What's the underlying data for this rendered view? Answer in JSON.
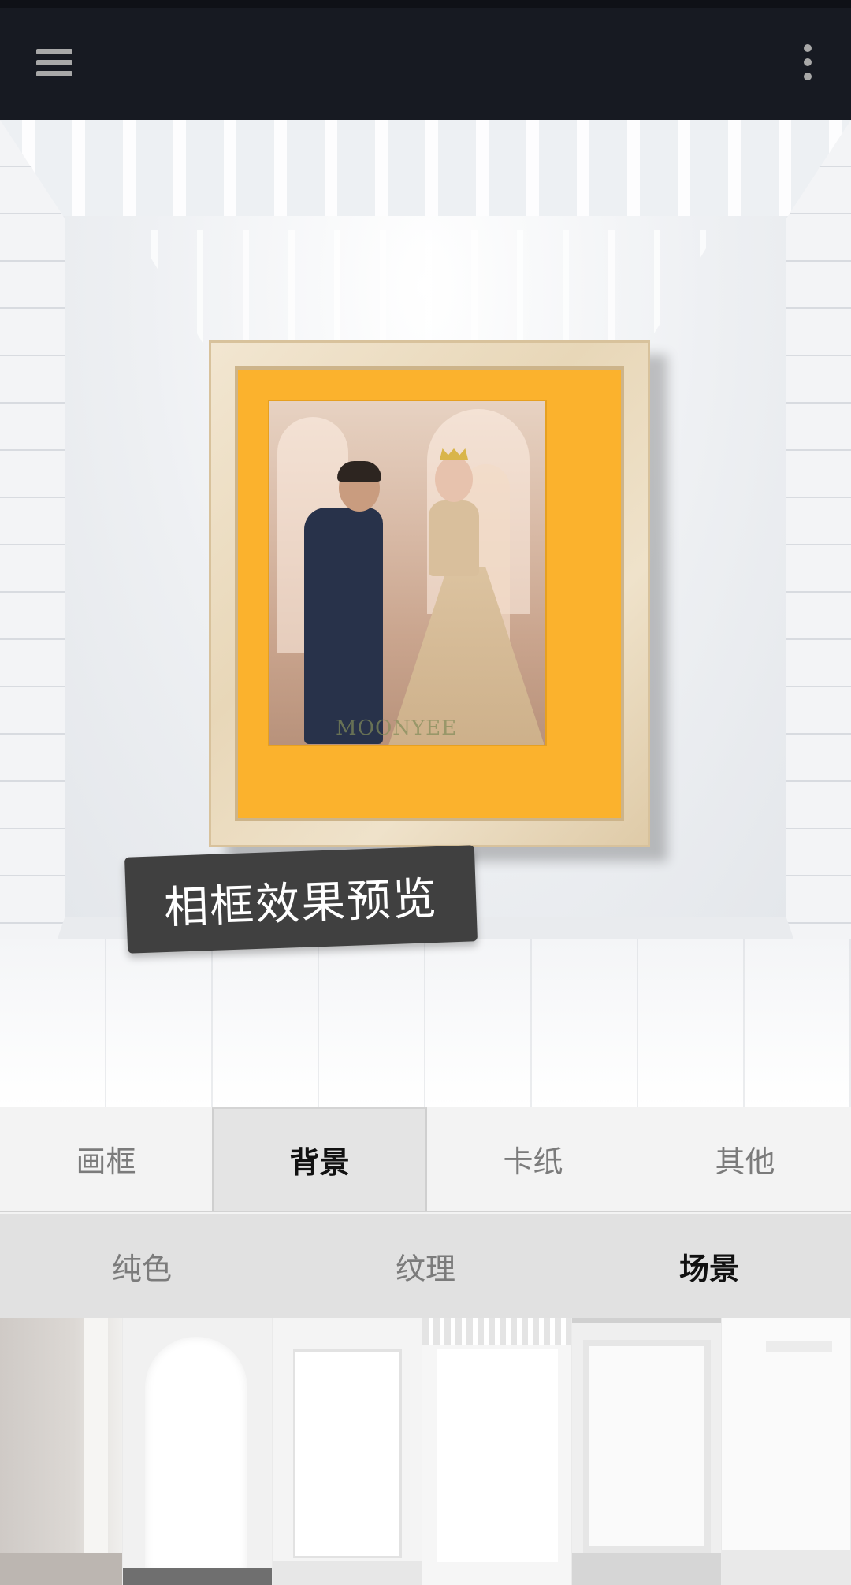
{
  "caption": "相框效果预览",
  "watermark": "MOONYEE",
  "tabs": [
    {
      "label": "画框",
      "active": false
    },
    {
      "label": "背景",
      "active": true
    },
    {
      "label": "卡纸",
      "active": false
    },
    {
      "label": "其他",
      "active": false
    }
  ],
  "subtabs": [
    {
      "label": "纯色",
      "active": false
    },
    {
      "label": "纹理",
      "active": false
    },
    {
      "label": "场景",
      "active": true
    }
  ],
  "colors": {
    "topbar": "#171a22",
    "mat": "#fbb22d",
    "active_tab_bg": "#e4e4e4"
  },
  "icons": [
    "menu-icon",
    "more-vertical-icon"
  ],
  "thumbnails": [
    "scene-1",
    "scene-2",
    "scene-3",
    "scene-4",
    "scene-5",
    "scene-6"
  ],
  "selected_thumbnail": 4
}
